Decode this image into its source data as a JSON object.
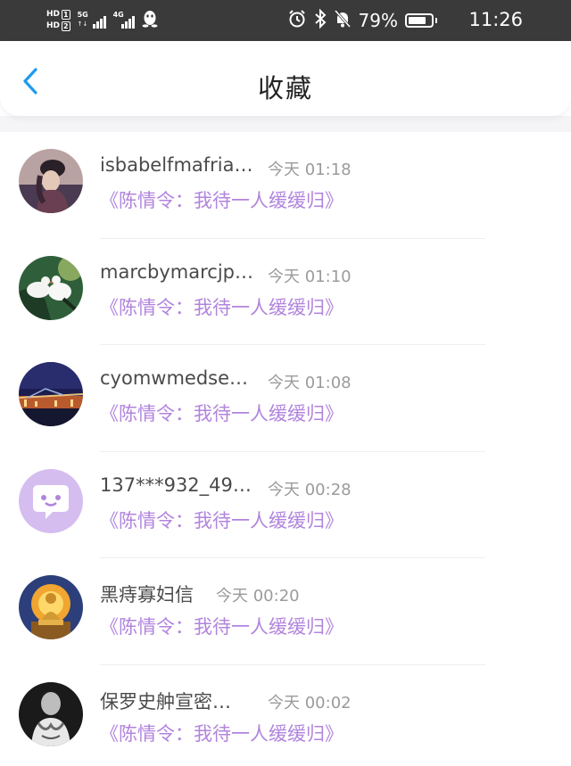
{
  "status_bar": {
    "hd1": "HD",
    "hd1_num": "1",
    "hd2": "HD",
    "hd2_num": "2",
    "net1_top": "5G",
    "net1_bottom": "↑↓",
    "net2_top": "4G",
    "battery_percent": "79%",
    "time": "11:26"
  },
  "header": {
    "title": "收藏"
  },
  "items": [
    {
      "name": "isbabelfmafria…",
      "time": "今天 01:18",
      "content": "《陈情令：我待一人缓缓归》"
    },
    {
      "name": "marcbymarcjp…",
      "time": "今天 01:10",
      "content": "《陈情令：我待一人缓缓归》"
    },
    {
      "name": "cyomwmedse…",
      "time": "今天 01:08",
      "content": "《陈情令：我待一人缓缓归》"
    },
    {
      "name": "137***932_49…",
      "time": "今天 00:28",
      "content": "《陈情令：我待一人缓缓归》"
    },
    {
      "name": "黑痔寡妇信",
      "time": "今天 00:20",
      "content": "《陈情令：我待一人缓缓归》"
    },
    {
      "name": "保罗史舯宣密…",
      "time": "今天 00:02",
      "content": "《陈情令：我待一人缓缓归》"
    }
  ],
  "colors": {
    "status_bar_bg": "#3a3a3a",
    "accent_back": "#1e9bf0",
    "content_purple": "#b184dd",
    "name_gray": "#4a4a4a",
    "time_gray": "#9b9b9b"
  },
  "icons": {
    "back": "chevron-left-icon",
    "alarm": "alarm-icon",
    "bluetooth": "bluetooth-icon",
    "mute": "bell-off-icon",
    "qq": "penguin-icon"
  }
}
